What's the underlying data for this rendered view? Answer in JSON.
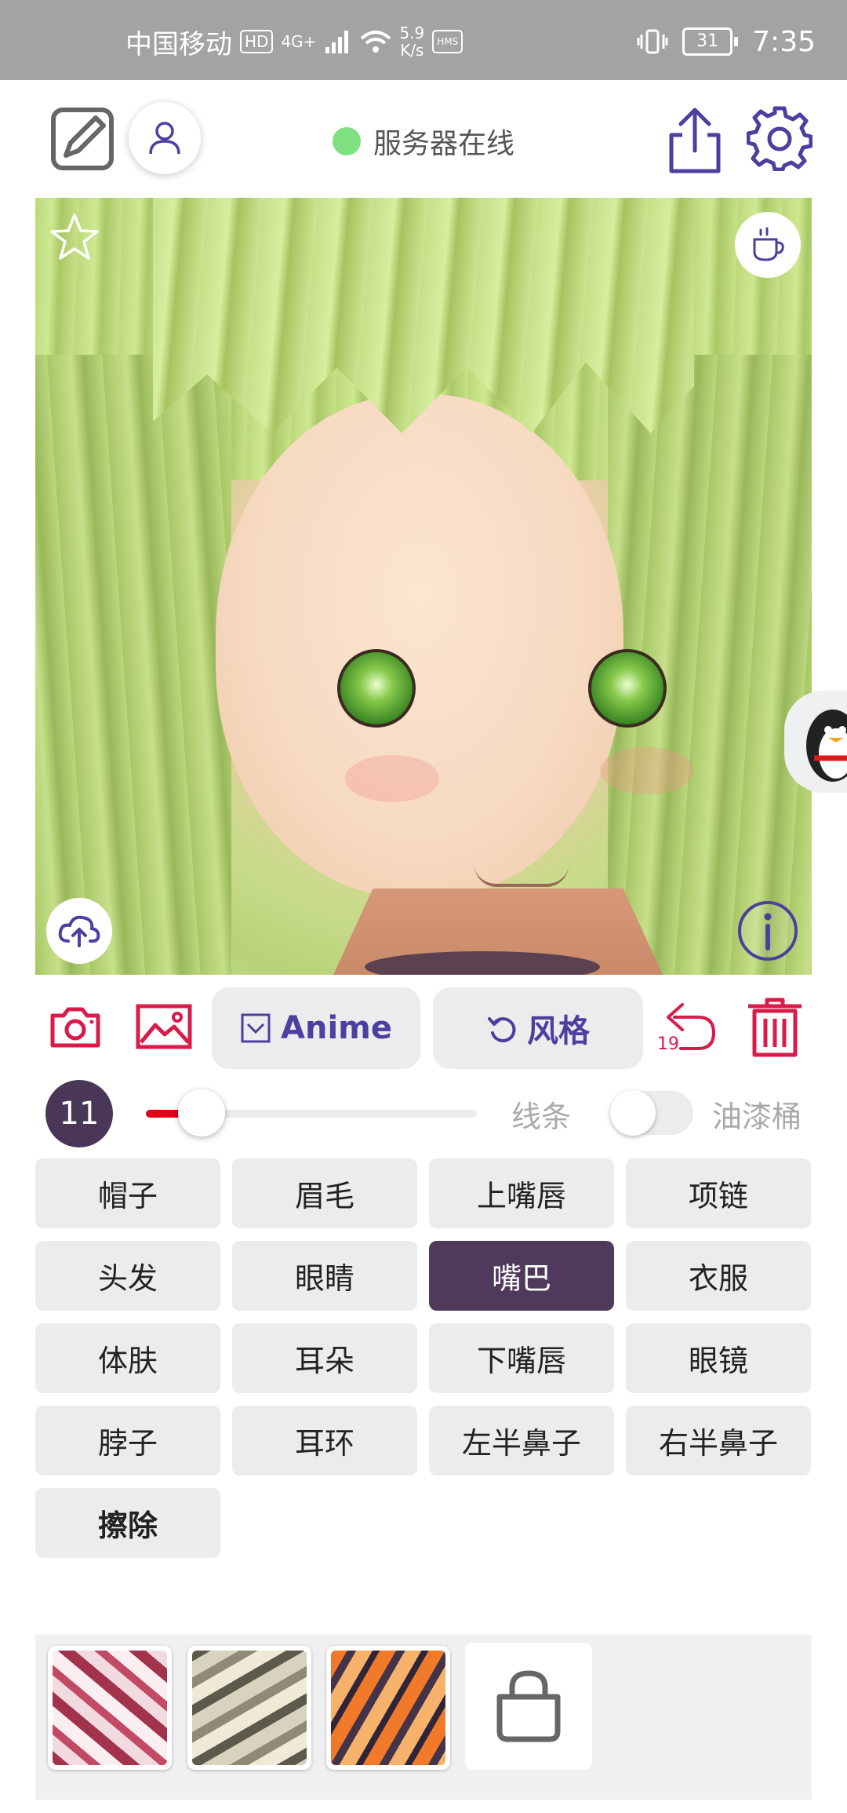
{
  "status_bar": {
    "carrier": "中国移动",
    "hd": "HD",
    "network": "4G+",
    "speed_value": "5.9",
    "speed_unit": "K/s",
    "hms": "HMS",
    "battery": "31",
    "time": "7:35"
  },
  "header": {
    "server_status": "服务器在线"
  },
  "toolbar": {
    "anime_label": "Anime",
    "style_label": "风格",
    "undo_count": "19"
  },
  "brush": {
    "size": "11",
    "slider_fraction": 0.12,
    "line_label": "线条",
    "bucket_label": "油漆桶",
    "bucket_enabled": false
  },
  "labels": [
    "帽子",
    "眉毛",
    "上嘴唇",
    "项链",
    "头发",
    "眼睛",
    "嘴巴",
    "衣服",
    "体肤",
    "耳朵",
    "下嘴唇",
    "眼镜",
    "脖子",
    "耳环",
    "左半鼻子",
    "右半鼻子",
    "擦除"
  ],
  "selected_label": "嘴巴",
  "colors": {
    "accent": "#4b3fa0",
    "danger": "#d91b49",
    "selected": "#4f3a5c",
    "online": "#7ee07e"
  },
  "icons": [
    "edit-icon",
    "user-icon",
    "share-icon",
    "gear-icon",
    "star-icon",
    "cup-icon",
    "upload-icon",
    "info-icon",
    "camera-icon",
    "image-icon",
    "undo-icon",
    "trash-icon",
    "bag-icon"
  ]
}
